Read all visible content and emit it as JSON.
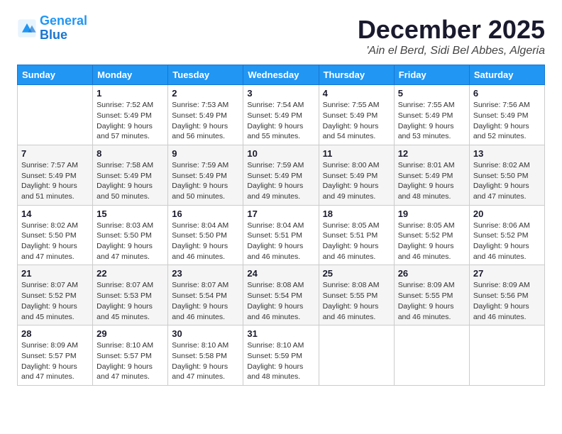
{
  "logo": {
    "line1": "General",
    "line2": "Blue"
  },
  "header": {
    "month": "December 2025",
    "location": "'Ain el Berd, Sidi Bel Abbes, Algeria"
  },
  "weekdays": [
    "Sunday",
    "Monday",
    "Tuesday",
    "Wednesday",
    "Thursday",
    "Friday",
    "Saturday"
  ],
  "weeks": [
    [
      {
        "day": "",
        "sunrise": "",
        "sunset": "",
        "daylight": ""
      },
      {
        "day": "1",
        "sunrise": "Sunrise: 7:52 AM",
        "sunset": "Sunset: 5:49 PM",
        "daylight": "Daylight: 9 hours and 57 minutes."
      },
      {
        "day": "2",
        "sunrise": "Sunrise: 7:53 AM",
        "sunset": "Sunset: 5:49 PM",
        "daylight": "Daylight: 9 hours and 56 minutes."
      },
      {
        "day": "3",
        "sunrise": "Sunrise: 7:54 AM",
        "sunset": "Sunset: 5:49 PM",
        "daylight": "Daylight: 9 hours and 55 minutes."
      },
      {
        "day": "4",
        "sunrise": "Sunrise: 7:55 AM",
        "sunset": "Sunset: 5:49 PM",
        "daylight": "Daylight: 9 hours and 54 minutes."
      },
      {
        "day": "5",
        "sunrise": "Sunrise: 7:55 AM",
        "sunset": "Sunset: 5:49 PM",
        "daylight": "Daylight: 9 hours and 53 minutes."
      },
      {
        "day": "6",
        "sunrise": "Sunrise: 7:56 AM",
        "sunset": "Sunset: 5:49 PM",
        "daylight": "Daylight: 9 hours and 52 minutes."
      }
    ],
    [
      {
        "day": "7",
        "sunrise": "Sunrise: 7:57 AM",
        "sunset": "Sunset: 5:49 PM",
        "daylight": "Daylight: 9 hours and 51 minutes."
      },
      {
        "day": "8",
        "sunrise": "Sunrise: 7:58 AM",
        "sunset": "Sunset: 5:49 PM",
        "daylight": "Daylight: 9 hours and 50 minutes."
      },
      {
        "day": "9",
        "sunrise": "Sunrise: 7:59 AM",
        "sunset": "Sunset: 5:49 PM",
        "daylight": "Daylight: 9 hours and 50 minutes."
      },
      {
        "day": "10",
        "sunrise": "Sunrise: 7:59 AM",
        "sunset": "Sunset: 5:49 PM",
        "daylight": "Daylight: 9 hours and 49 minutes."
      },
      {
        "day": "11",
        "sunrise": "Sunrise: 8:00 AM",
        "sunset": "Sunset: 5:49 PM",
        "daylight": "Daylight: 9 hours and 49 minutes."
      },
      {
        "day": "12",
        "sunrise": "Sunrise: 8:01 AM",
        "sunset": "Sunset: 5:49 PM",
        "daylight": "Daylight: 9 hours and 48 minutes."
      },
      {
        "day": "13",
        "sunrise": "Sunrise: 8:02 AM",
        "sunset": "Sunset: 5:50 PM",
        "daylight": "Daylight: 9 hours and 47 minutes."
      }
    ],
    [
      {
        "day": "14",
        "sunrise": "Sunrise: 8:02 AM",
        "sunset": "Sunset: 5:50 PM",
        "daylight": "Daylight: 9 hours and 47 minutes."
      },
      {
        "day": "15",
        "sunrise": "Sunrise: 8:03 AM",
        "sunset": "Sunset: 5:50 PM",
        "daylight": "Daylight: 9 hours and 47 minutes."
      },
      {
        "day": "16",
        "sunrise": "Sunrise: 8:04 AM",
        "sunset": "Sunset: 5:50 PM",
        "daylight": "Daylight: 9 hours and 46 minutes."
      },
      {
        "day": "17",
        "sunrise": "Sunrise: 8:04 AM",
        "sunset": "Sunset: 5:51 PM",
        "daylight": "Daylight: 9 hours and 46 minutes."
      },
      {
        "day": "18",
        "sunrise": "Sunrise: 8:05 AM",
        "sunset": "Sunset: 5:51 PM",
        "daylight": "Daylight: 9 hours and 46 minutes."
      },
      {
        "day": "19",
        "sunrise": "Sunrise: 8:05 AM",
        "sunset": "Sunset: 5:52 PM",
        "daylight": "Daylight: 9 hours and 46 minutes."
      },
      {
        "day": "20",
        "sunrise": "Sunrise: 8:06 AM",
        "sunset": "Sunset: 5:52 PM",
        "daylight": "Daylight: 9 hours and 46 minutes."
      }
    ],
    [
      {
        "day": "21",
        "sunrise": "Sunrise: 8:07 AM",
        "sunset": "Sunset: 5:52 PM",
        "daylight": "Daylight: 9 hours and 45 minutes."
      },
      {
        "day": "22",
        "sunrise": "Sunrise: 8:07 AM",
        "sunset": "Sunset: 5:53 PM",
        "daylight": "Daylight: 9 hours and 45 minutes."
      },
      {
        "day": "23",
        "sunrise": "Sunrise: 8:07 AM",
        "sunset": "Sunset: 5:54 PM",
        "daylight": "Daylight: 9 hours and 46 minutes."
      },
      {
        "day": "24",
        "sunrise": "Sunrise: 8:08 AM",
        "sunset": "Sunset: 5:54 PM",
        "daylight": "Daylight: 9 hours and 46 minutes."
      },
      {
        "day": "25",
        "sunrise": "Sunrise: 8:08 AM",
        "sunset": "Sunset: 5:55 PM",
        "daylight": "Daylight: 9 hours and 46 minutes."
      },
      {
        "day": "26",
        "sunrise": "Sunrise: 8:09 AM",
        "sunset": "Sunset: 5:55 PM",
        "daylight": "Daylight: 9 hours and 46 minutes."
      },
      {
        "day": "27",
        "sunrise": "Sunrise: 8:09 AM",
        "sunset": "Sunset: 5:56 PM",
        "daylight": "Daylight: 9 hours and 46 minutes."
      }
    ],
    [
      {
        "day": "28",
        "sunrise": "Sunrise: 8:09 AM",
        "sunset": "Sunset: 5:57 PM",
        "daylight": "Daylight: 9 hours and 47 minutes."
      },
      {
        "day": "29",
        "sunrise": "Sunrise: 8:10 AM",
        "sunset": "Sunset: 5:57 PM",
        "daylight": "Daylight: 9 hours and 47 minutes."
      },
      {
        "day": "30",
        "sunrise": "Sunrise: 8:10 AM",
        "sunset": "Sunset: 5:58 PM",
        "daylight": "Daylight: 9 hours and 47 minutes."
      },
      {
        "day": "31",
        "sunrise": "Sunrise: 8:10 AM",
        "sunset": "Sunset: 5:59 PM",
        "daylight": "Daylight: 9 hours and 48 minutes."
      },
      {
        "day": "",
        "sunrise": "",
        "sunset": "",
        "daylight": ""
      },
      {
        "day": "",
        "sunrise": "",
        "sunset": "",
        "daylight": ""
      },
      {
        "day": "",
        "sunrise": "",
        "sunset": "",
        "daylight": ""
      }
    ]
  ]
}
